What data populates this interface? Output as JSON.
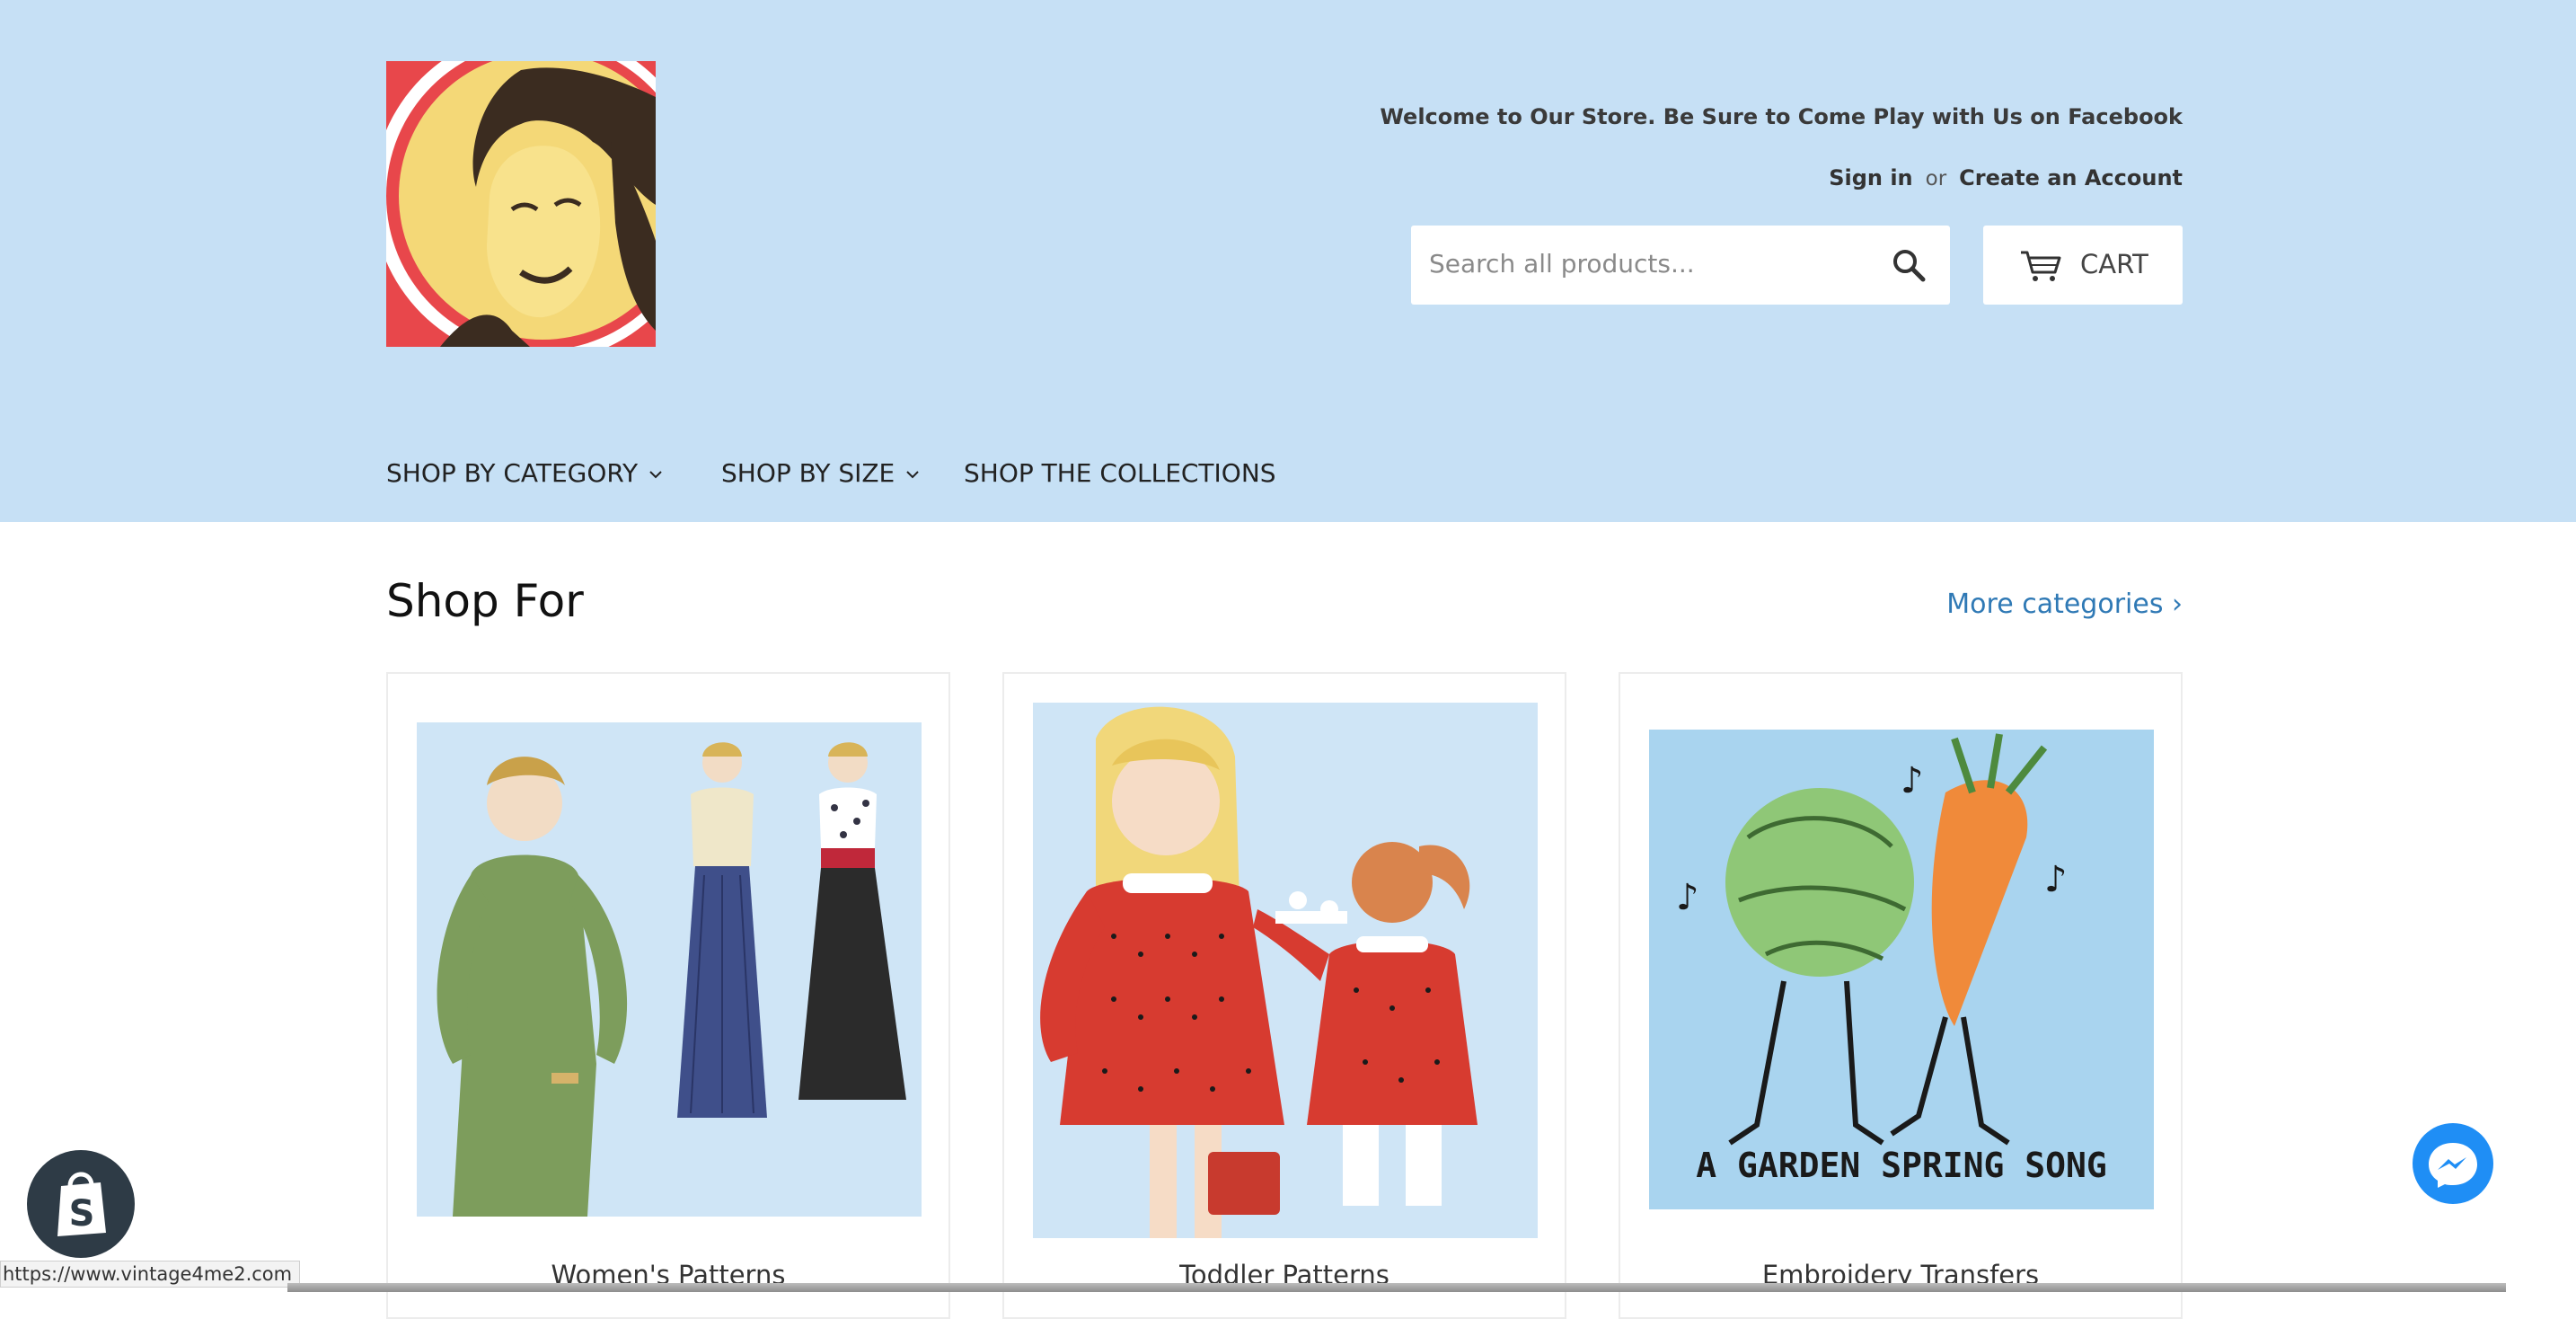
{
  "header": {
    "welcome_text": "Welcome to Our Store. Be Sure to Come Play with Us on Facebook",
    "sign_in": "Sign in",
    "or": "or",
    "create_account": "Create an Account",
    "search_placeholder": "Search all products...",
    "cart_label": "CART",
    "logo_icon": "vintage-woman-portrait-logo"
  },
  "nav": {
    "items": [
      {
        "label": "SHOP BY CATEGORY",
        "has_dropdown": true
      },
      {
        "label": "SHOP BY SIZE",
        "has_dropdown": true
      },
      {
        "label": "SHOP THE COLLECTIONS",
        "has_dropdown": false
      }
    ]
  },
  "main": {
    "section_title": "Shop For",
    "more_link": "More categories ›",
    "cards": [
      {
        "caption": "Women's Patterns"
      },
      {
        "caption": "Toddler Patterns"
      },
      {
        "caption": "Embroidery Transfers",
        "art_text": "A GARDEN SPRING SONG"
      }
    ]
  },
  "status_bar": {
    "url": "https://www.vintage4me2.com"
  },
  "colors": {
    "header_bg": "#c6e0f5",
    "link_blue": "#2f79b5",
    "messenger_blue": "#1f8ef5",
    "shopify_dark": "#2e3b46"
  },
  "icons": [
    "search-icon",
    "cart-icon",
    "chevron-down-icon",
    "shopify-bag-icon",
    "messenger-icon"
  ]
}
